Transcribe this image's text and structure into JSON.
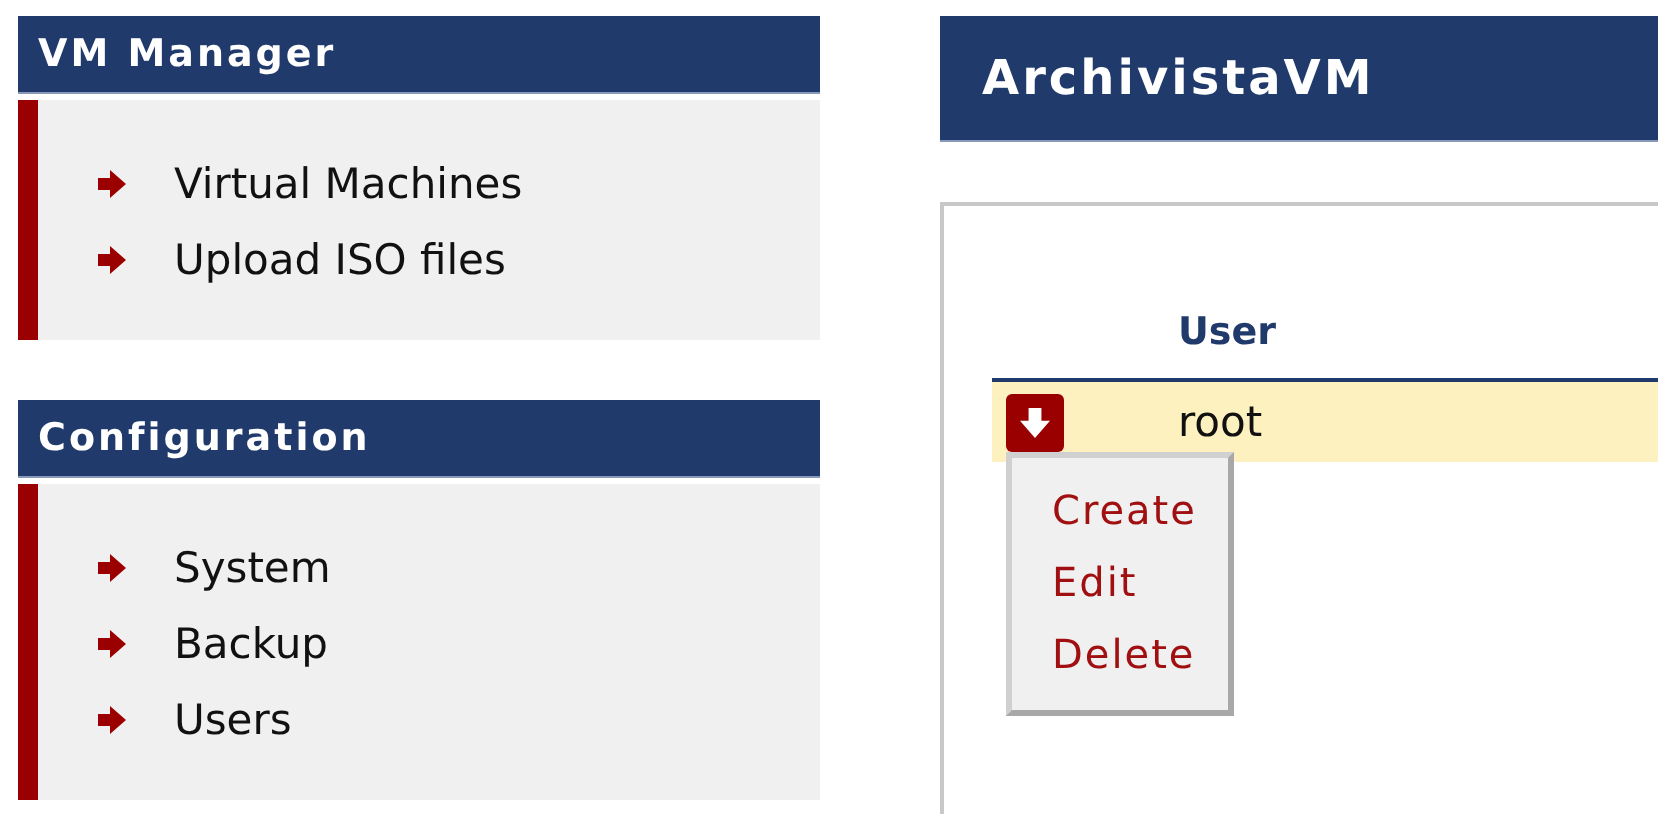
{
  "sidebar": [
    {
      "title": "VM Manager",
      "items": [
        {
          "label": "Virtual Machines"
        },
        {
          "label": "Upload ISO files"
        }
      ]
    },
    {
      "title": "Configuration",
      "items": [
        {
          "label": "System"
        },
        {
          "label": "Backup"
        },
        {
          "label": "Users"
        }
      ]
    }
  ],
  "main": {
    "title": "ArchivistaVM",
    "table": {
      "columns": [
        "User"
      ],
      "rows": [
        {
          "cells": [
            "root"
          ],
          "selected": true,
          "menu_expanded": true
        }
      ]
    },
    "menu": {
      "items": [
        "Create",
        "Edit",
        "Delete"
      ]
    }
  }
}
